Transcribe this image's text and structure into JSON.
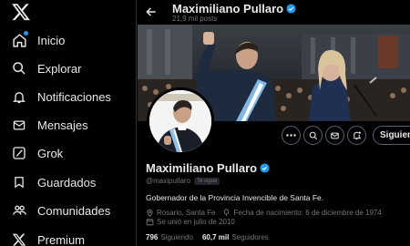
{
  "nav": {
    "items": [
      {
        "label": "Inicio",
        "icon": "home-icon"
      },
      {
        "label": "Explorar",
        "icon": "search-icon"
      },
      {
        "label": "Notificaciones",
        "icon": "bell-icon"
      },
      {
        "label": "Mensajes",
        "icon": "mail-icon"
      },
      {
        "label": "Grok",
        "icon": "grok-icon"
      },
      {
        "label": "Guardados",
        "icon": "bookmark-icon"
      },
      {
        "label": "Comunidades",
        "icon": "communities-icon"
      },
      {
        "label": "Premium",
        "icon": "x-premium-icon"
      }
    ]
  },
  "header": {
    "name": "Maximiliano Pullaro",
    "posts": "21,9 mil posts"
  },
  "profile": {
    "name": "Maximiliano Pullaro",
    "handle": "@maxipullaro",
    "follows_you": "Te sigue",
    "bio": "Gobernador de la Provincia Invencible de Santa Fe.",
    "location": "Rosario, Santa Fe",
    "birthdate": "Fecha de nacimiento: 6 de diciembre de 1974",
    "joined": "Se unió en julio de 2010",
    "following_count": "796",
    "following_label": "Siguiendo",
    "followers_count": "60,7 mil",
    "followers_label": "Seguidores",
    "follow_button": "Siguiendo"
  },
  "colors": {
    "accent": "#1d9bf0",
    "background": "#000000",
    "text_secondary": "#71767b"
  }
}
